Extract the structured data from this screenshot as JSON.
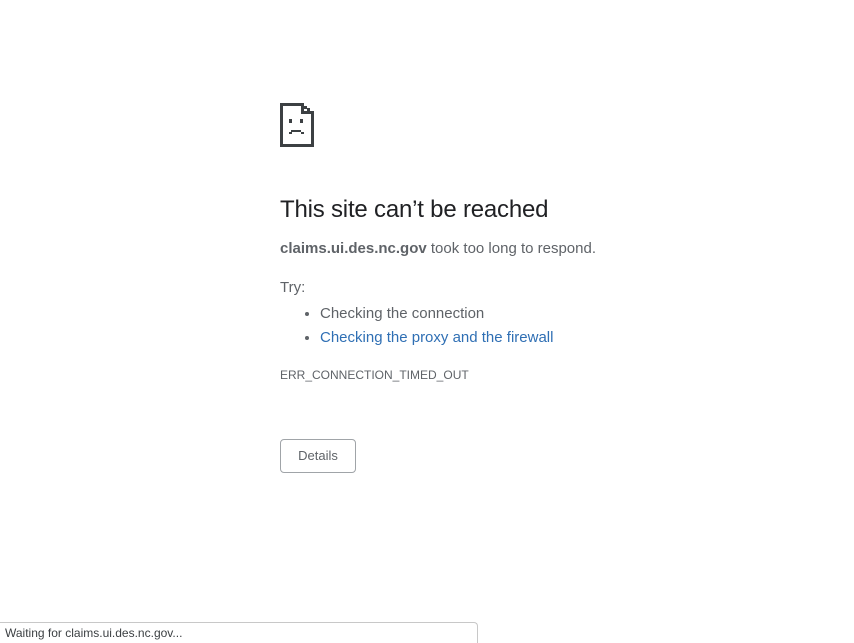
{
  "error_page": {
    "icon": "sad-page-icon",
    "title": "This site can’t be reached",
    "host": "claims.ui.des.nc.gov",
    "summary_rest": " took too long to respond.",
    "try_label": "Try:",
    "suggestions": [
      "Checking the connection",
      "Checking the proxy and the firewall"
    ],
    "error_code": "ERR_CONNECTION_TIMED_OUT",
    "details_label": "Details"
  },
  "status_bar": {
    "text": "Waiting for claims.ui.des.nc.gov..."
  },
  "colors": {
    "title": "#202124",
    "body_text": "#5f6368",
    "link": "#2f6fb4",
    "button_border": "#a0a4a8"
  }
}
